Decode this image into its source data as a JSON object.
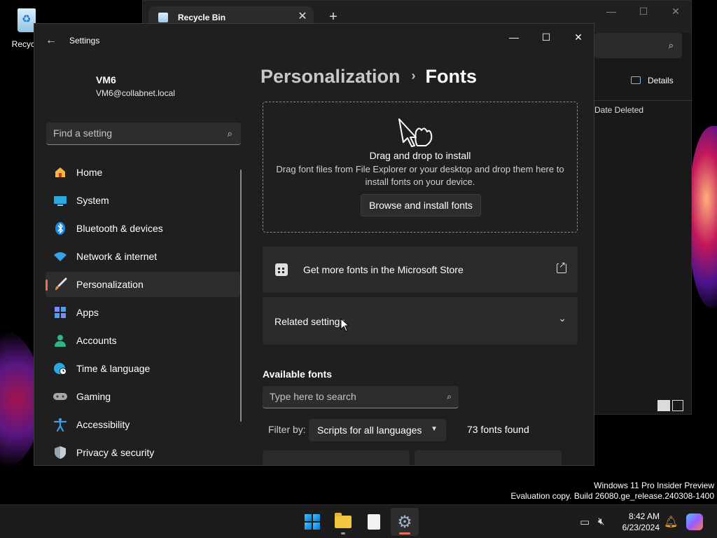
{
  "desktop": {
    "icon_label": "Recycle"
  },
  "explorer": {
    "tab_label": "Recycle Bin",
    "close_tab": "✕",
    "new_tab": "+",
    "details_label": "Details",
    "column_header": "Date Deleted"
  },
  "settings": {
    "app_title": "Settings",
    "profile": {
      "name": "VM6",
      "email": "VM6@collabnet.local"
    },
    "search": {
      "placeholder": "Find a setting"
    },
    "nav": [
      {
        "label": "Home",
        "icon": "home-icon"
      },
      {
        "label": "System",
        "icon": "system-icon"
      },
      {
        "label": "Bluetooth & devices",
        "icon": "bluetooth-icon"
      },
      {
        "label": "Network & internet",
        "icon": "wifi-icon"
      },
      {
        "label": "Personalization",
        "icon": "brush-icon",
        "active": true
      },
      {
        "label": "Apps",
        "icon": "apps-icon"
      },
      {
        "label": "Accounts",
        "icon": "account-icon"
      },
      {
        "label": "Time & language",
        "icon": "globe-icon"
      },
      {
        "label": "Gaming",
        "icon": "gamepad-icon"
      },
      {
        "label": "Accessibility",
        "icon": "accessibility-icon"
      },
      {
        "label": "Privacy & security",
        "icon": "shield-icon"
      }
    ],
    "breadcrumb": {
      "parent": "Personalization",
      "separator": "›",
      "current": "Fonts"
    },
    "dropzone": {
      "title": "Drag and drop to install",
      "subtitle": "Drag font files from File Explorer or your desktop and drop them here to install fonts on your device.",
      "button": "Browse and install fonts"
    },
    "store_card": {
      "label": "Get more fonts in the Microsoft Store"
    },
    "related": {
      "label": "Related settings"
    },
    "available": {
      "heading": "Available fonts",
      "search_placeholder": "Type here to search",
      "filter_label": "Filter by:",
      "filter_value": "Scripts for all languages",
      "count": "73 fonts found"
    }
  },
  "watermark": {
    "line1": "Windows 11 Pro Insider Preview",
    "line2": "Evaluation copy. Build 26080.ge_release.240308-1400"
  },
  "taskbar": {
    "time": "8:42 AM",
    "date": "6/23/2024"
  },
  "colors": {
    "accent": "#e8715b",
    "window_bg": "#1f1f1f",
    "card_bg": "#2b2b2b"
  }
}
